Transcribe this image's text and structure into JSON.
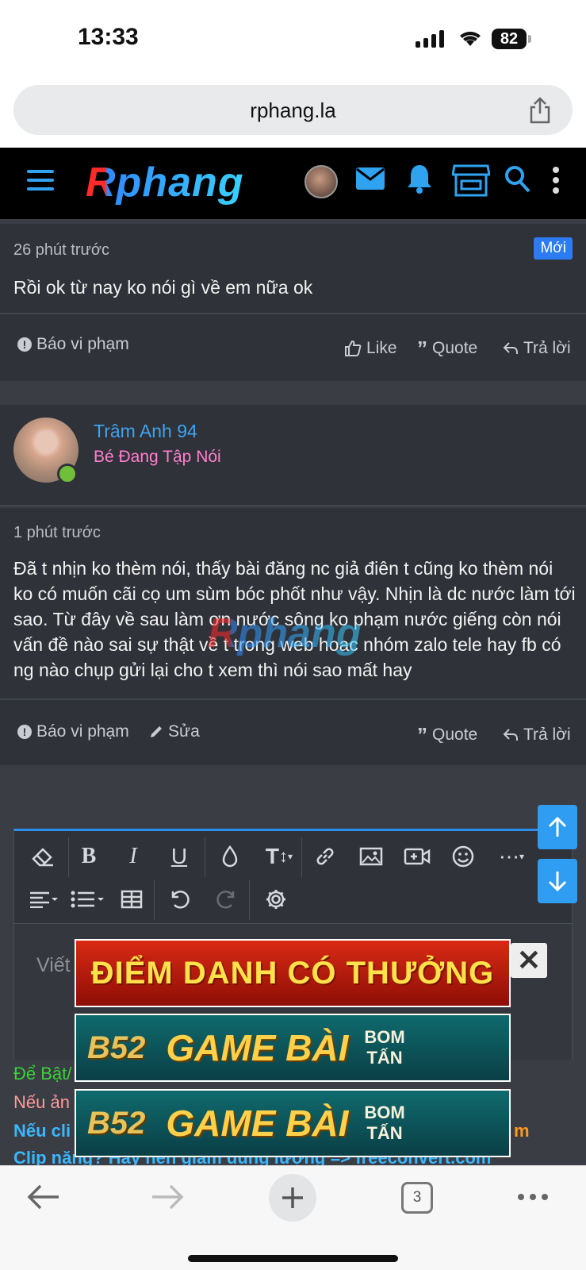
{
  "status": {
    "time": "13:33",
    "battery": "82"
  },
  "browser": {
    "url": "rphang.la",
    "tab_count": "3"
  },
  "site": {
    "logo": "Rphang"
  },
  "post1": {
    "time": "26 phút trước",
    "badge": "Mới",
    "body": "Rồi ok từ nay ko nói gì về em nữa ok",
    "report": "Báo vi phạm",
    "like": "Like",
    "quote": "Quote",
    "reply": "Trả lời"
  },
  "post2": {
    "username": "Trâm Anh 94",
    "user_title": "Bé Đang Tập Nói",
    "time": "1 phút trước",
    "body": "Đã t nhịn ko thèm nói, thấy bài đăng nc giả điên t cũng ko thèm nói ko có muốn cãi cọ um sùm bóc phốt như vậy. Nhịn là dc nước làm tới sao. Từ đây về sau làm ơn nước sông ko phạm nước giếng còn nói vấn đề nào sai sự thật về t trong web hoac nhóm zalo tele hay fb có ng nào chụp gửi lại cho t xem thì nói sao mất hay",
    "report": "Báo vi phạm",
    "edit": "Sửa",
    "quote": "Quote",
    "reply": "Trả lời"
  },
  "watermark": "Rphang",
  "editor": {
    "placeholder": "Viết"
  },
  "info_lines": {
    "line1": "Để Bật/",
    "line2": "Nếu ản",
    "line3": "Nếu cli",
    "line3_tail": "m",
    "line4": "Clip nặng? Hãy nén giảm dung lượng => freeconvert.com"
  },
  "ads": {
    "ad1": "ĐIỂM DANH CÓ THƯỞNG",
    "game_brand": "B52",
    "game_title": "GAME BÀI",
    "game_tag_1": "BOM",
    "game_tag_2": "TẤN",
    "close": "✕"
  },
  "colors": {
    "accent": "#2d8ef0",
    "username": "#3ea4ef",
    "user_title": "#ff7fd0",
    "new_badge": "#2d7bf0"
  }
}
